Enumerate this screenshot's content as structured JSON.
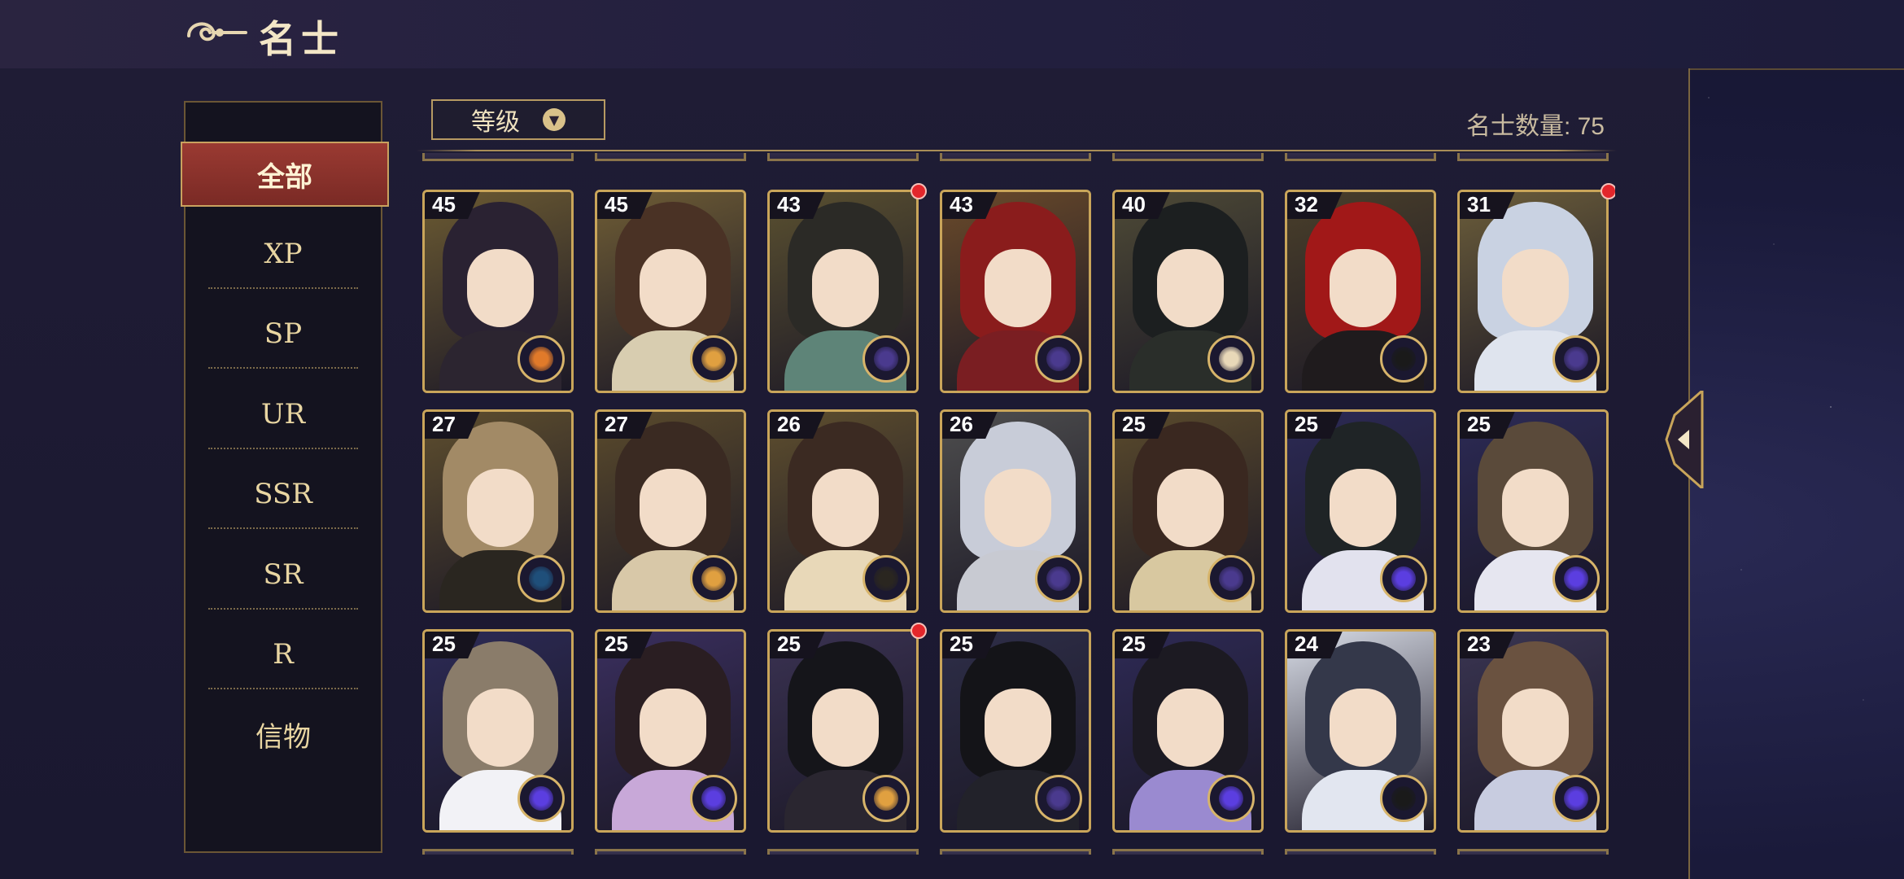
{
  "header": {
    "title": "名士"
  },
  "sidebar": {
    "items": [
      {
        "label": "全部",
        "active": true
      },
      {
        "label": "XP"
      },
      {
        "label": "SP"
      },
      {
        "label": "UR"
      },
      {
        "label": "SSR"
      },
      {
        "label": "SR"
      },
      {
        "label": "R"
      },
      {
        "label": "信物"
      }
    ]
  },
  "toolbar": {
    "sort_label": "等级",
    "count_text": "名士数量: 75"
  },
  "colors": {
    "accent_red": "#9a3a32",
    "gold_border": "#c9a55a",
    "notification": "#e3262b"
  },
  "cards": [
    {
      "level": "45",
      "hair": "#2a2232",
      "bg": "#6b5a32",
      "body": "#2c2530",
      "badge": "sun-badge-icon",
      "badge_color": "#e07a2a",
      "dot": false
    },
    {
      "level": "45",
      "hair": "#4a3225",
      "bg": "#6e5c35",
      "body": "#d8cdb0",
      "badge": "sun-badge-icon",
      "badge_color": "#e0a040",
      "dot": false
    },
    {
      "level": "43",
      "hair": "#2b2a26",
      "bg": "#5a5030",
      "body": "#5e8478",
      "badge": "moon-badge-icon",
      "badge_color": "#4a3a8e",
      "dot": true
    },
    {
      "level": "43",
      "hair": "#8a1c1c",
      "bg": "#6a4a2a",
      "body": "#7a1e22",
      "badge": "moon-badge-icon",
      "badge_color": "#4a3a8e",
      "dot": false
    },
    {
      "level": "40",
      "hair": "#1c1f20",
      "bg": "#4e4a36",
      "body": "#2a2e2a",
      "badge": "sun-badge-icon",
      "badge_color": "#e8d8b8",
      "dot": false
    },
    {
      "level": "32",
      "hair": "#a11818",
      "bg": "#4a3f2a",
      "body": "#1f1b1d",
      "badge": "eye-badge-icon",
      "badge_color": "#1a1a1a",
      "dot": false
    },
    {
      "level": "31",
      "hair": "#c9d2e2",
      "bg": "#6b5d3a",
      "body": "#dfe4ee",
      "badge": "moon-badge-icon",
      "badge_color": "#4a3a8e",
      "dot": true
    },
    {
      "level": "27",
      "hair": "#a28a66",
      "bg": "#5e4e2e",
      "body": "#2a2620",
      "badge": "star-badge-icon",
      "badge_color": "#1f4f7a",
      "dot": false
    },
    {
      "level": "27",
      "hair": "#3a2a22",
      "bg": "#5a4a2c",
      "body": "#d8c8a8",
      "badge": "sun-badge-icon",
      "badge_color": "#e0a040",
      "dot": false
    },
    {
      "level": "26",
      "hair": "#3b2a22",
      "bg": "#5e4e2e",
      "body": "#e8d8b8",
      "badge": "eye-badge-icon",
      "badge_color": "#2a2620",
      "dot": false
    },
    {
      "level": "26",
      "hair": "#c8ccd8",
      "bg": "#4e4e4e",
      "body": "#c8cad2",
      "badge": "moon-badge-icon",
      "badge_color": "#4a3a8e",
      "dot": false
    },
    {
      "level": "25",
      "hair": "#3a2820",
      "bg": "#5a4a2c",
      "body": "#d8c8a0",
      "badge": "moon-badge-icon",
      "badge_color": "#4a3a8e",
      "dot": false
    },
    {
      "level": "25",
      "hair": "#1f2426",
      "bg": "#2c2a55",
      "body": "#e2e2ee",
      "badge": "orb-badge-icon",
      "badge_color": "#5b3ee0",
      "dot": false
    },
    {
      "level": "25",
      "hair": "#5a4a3a",
      "bg": "#2c2a55",
      "body": "#e6e6f0",
      "badge": "orb-badge-icon",
      "badge_color": "#5b3ee0",
      "dot": false
    },
    {
      "level": "25",
      "hair": "#8a7c6a",
      "bg": "#2c2a55",
      "body": "#f2f2f6",
      "badge": "orb-badge-icon",
      "badge_color": "#5b3ee0",
      "dot": false
    },
    {
      "level": "25",
      "hair": "#2a1e22",
      "bg": "#3a2f5e",
      "body": "#c8a8d8",
      "badge": "orb-badge-icon",
      "badge_color": "#5b3ee0",
      "dot": false
    },
    {
      "level": "25",
      "hair": "#15151a",
      "bg": "#3a3252",
      "body": "#2a2630",
      "badge": "sun-badge-icon",
      "badge_color": "#e0a040",
      "dot": true
    },
    {
      "level": "25",
      "hair": "#141418",
      "bg": "#2e2e48",
      "body": "#22222a",
      "badge": "moon-badge-icon",
      "badge_color": "#4a3a8e",
      "dot": false
    },
    {
      "level": "25",
      "hair": "#1c1a22",
      "bg": "#2e2a55",
      "body": "#9a8ad0",
      "badge": "orb-badge-icon",
      "badge_color": "#5b3ee0",
      "dot": false
    },
    {
      "level": "24",
      "hair": "#34384a",
      "bg": "#d8dce6",
      "body": "#e2e6f0",
      "badge": "eye-badge-icon",
      "badge_color": "#1a1a1a",
      "dot": false
    },
    {
      "level": "23",
      "hair": "#6a5240",
      "bg": "#3a3552",
      "body": "#c8cce0",
      "badge": "orb-badge-icon",
      "badge_color": "#5b3ee0",
      "dot": false
    }
  ]
}
